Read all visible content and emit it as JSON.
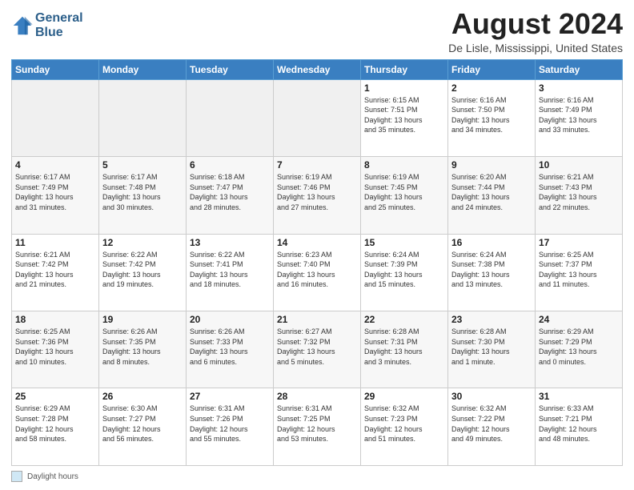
{
  "header": {
    "logo_line1": "General",
    "logo_line2": "Blue",
    "month_title": "August 2024",
    "location": "De Lisle, Mississippi, United States"
  },
  "footer": {
    "daylight_label": "Daylight hours"
  },
  "days_of_week": [
    "Sunday",
    "Monday",
    "Tuesday",
    "Wednesday",
    "Thursday",
    "Friday",
    "Saturday"
  ],
  "weeks": [
    [
      {
        "day": "",
        "info": ""
      },
      {
        "day": "",
        "info": ""
      },
      {
        "day": "",
        "info": ""
      },
      {
        "day": "",
        "info": ""
      },
      {
        "day": "1",
        "info": "Sunrise: 6:15 AM\nSunset: 7:51 PM\nDaylight: 13 hours\nand 35 minutes."
      },
      {
        "day": "2",
        "info": "Sunrise: 6:16 AM\nSunset: 7:50 PM\nDaylight: 13 hours\nand 34 minutes."
      },
      {
        "day": "3",
        "info": "Sunrise: 6:16 AM\nSunset: 7:49 PM\nDaylight: 13 hours\nand 33 minutes."
      }
    ],
    [
      {
        "day": "4",
        "info": "Sunrise: 6:17 AM\nSunset: 7:49 PM\nDaylight: 13 hours\nand 31 minutes."
      },
      {
        "day": "5",
        "info": "Sunrise: 6:17 AM\nSunset: 7:48 PM\nDaylight: 13 hours\nand 30 minutes."
      },
      {
        "day": "6",
        "info": "Sunrise: 6:18 AM\nSunset: 7:47 PM\nDaylight: 13 hours\nand 28 minutes."
      },
      {
        "day": "7",
        "info": "Sunrise: 6:19 AM\nSunset: 7:46 PM\nDaylight: 13 hours\nand 27 minutes."
      },
      {
        "day": "8",
        "info": "Sunrise: 6:19 AM\nSunset: 7:45 PM\nDaylight: 13 hours\nand 25 minutes."
      },
      {
        "day": "9",
        "info": "Sunrise: 6:20 AM\nSunset: 7:44 PM\nDaylight: 13 hours\nand 24 minutes."
      },
      {
        "day": "10",
        "info": "Sunrise: 6:21 AM\nSunset: 7:43 PM\nDaylight: 13 hours\nand 22 minutes."
      }
    ],
    [
      {
        "day": "11",
        "info": "Sunrise: 6:21 AM\nSunset: 7:42 PM\nDaylight: 13 hours\nand 21 minutes."
      },
      {
        "day": "12",
        "info": "Sunrise: 6:22 AM\nSunset: 7:42 PM\nDaylight: 13 hours\nand 19 minutes."
      },
      {
        "day": "13",
        "info": "Sunrise: 6:22 AM\nSunset: 7:41 PM\nDaylight: 13 hours\nand 18 minutes."
      },
      {
        "day": "14",
        "info": "Sunrise: 6:23 AM\nSunset: 7:40 PM\nDaylight: 13 hours\nand 16 minutes."
      },
      {
        "day": "15",
        "info": "Sunrise: 6:24 AM\nSunset: 7:39 PM\nDaylight: 13 hours\nand 15 minutes."
      },
      {
        "day": "16",
        "info": "Sunrise: 6:24 AM\nSunset: 7:38 PM\nDaylight: 13 hours\nand 13 minutes."
      },
      {
        "day": "17",
        "info": "Sunrise: 6:25 AM\nSunset: 7:37 PM\nDaylight: 13 hours\nand 11 minutes."
      }
    ],
    [
      {
        "day": "18",
        "info": "Sunrise: 6:25 AM\nSunset: 7:36 PM\nDaylight: 13 hours\nand 10 minutes."
      },
      {
        "day": "19",
        "info": "Sunrise: 6:26 AM\nSunset: 7:35 PM\nDaylight: 13 hours\nand 8 minutes."
      },
      {
        "day": "20",
        "info": "Sunrise: 6:26 AM\nSunset: 7:33 PM\nDaylight: 13 hours\nand 6 minutes."
      },
      {
        "day": "21",
        "info": "Sunrise: 6:27 AM\nSunset: 7:32 PM\nDaylight: 13 hours\nand 5 minutes."
      },
      {
        "day": "22",
        "info": "Sunrise: 6:28 AM\nSunset: 7:31 PM\nDaylight: 13 hours\nand 3 minutes."
      },
      {
        "day": "23",
        "info": "Sunrise: 6:28 AM\nSunset: 7:30 PM\nDaylight: 13 hours\nand 1 minute."
      },
      {
        "day": "24",
        "info": "Sunrise: 6:29 AM\nSunset: 7:29 PM\nDaylight: 13 hours\nand 0 minutes."
      }
    ],
    [
      {
        "day": "25",
        "info": "Sunrise: 6:29 AM\nSunset: 7:28 PM\nDaylight: 12 hours\nand 58 minutes."
      },
      {
        "day": "26",
        "info": "Sunrise: 6:30 AM\nSunset: 7:27 PM\nDaylight: 12 hours\nand 56 minutes."
      },
      {
        "day": "27",
        "info": "Sunrise: 6:31 AM\nSunset: 7:26 PM\nDaylight: 12 hours\nand 55 minutes."
      },
      {
        "day": "28",
        "info": "Sunrise: 6:31 AM\nSunset: 7:25 PM\nDaylight: 12 hours\nand 53 minutes."
      },
      {
        "day": "29",
        "info": "Sunrise: 6:32 AM\nSunset: 7:23 PM\nDaylight: 12 hours\nand 51 minutes."
      },
      {
        "day": "30",
        "info": "Sunrise: 6:32 AM\nSunset: 7:22 PM\nDaylight: 12 hours\nand 49 minutes."
      },
      {
        "day": "31",
        "info": "Sunrise: 6:33 AM\nSunset: 7:21 PM\nDaylight: 12 hours\nand 48 minutes."
      }
    ]
  ]
}
